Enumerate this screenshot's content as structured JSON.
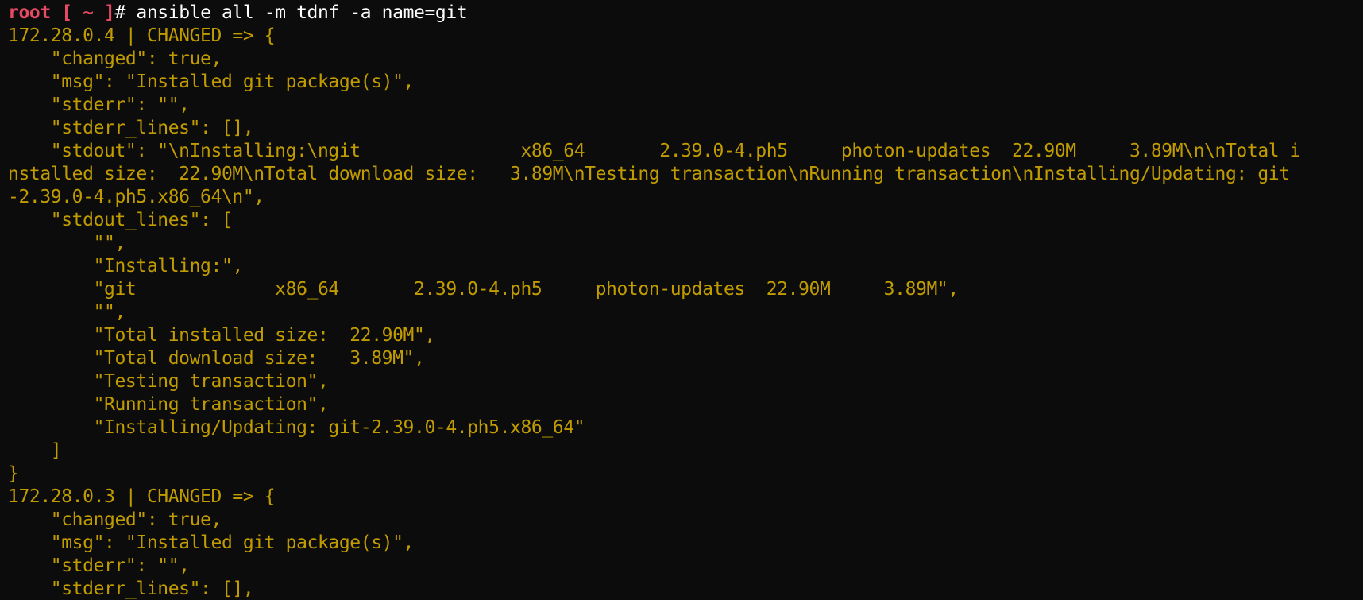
{
  "colors": {
    "background": "#0c0c0c",
    "prompt": "#e84a63",
    "command": "#ffffff",
    "output": "#c19c00"
  },
  "prompt": {
    "user": "root",
    "open_bracket": " [",
    "path": " ~ ",
    "close_bracket": "]",
    "hash": "#",
    "command": " ansible all -m tdnf -a name=git"
  },
  "output_lines": [
    "172.28.0.4 | CHANGED => {",
    "    \"changed\": true,",
    "    \"msg\": \"Installed git package(s)\",",
    "    \"stderr\": \"\",",
    "    \"stderr_lines\": [],",
    "    \"stdout\": \"\\nInstalling:\\ngit               x86_64       2.39.0-4.ph5     photon-updates  22.90M     3.89M\\n\\nTotal i",
    "nstalled size:  22.90M\\nTotal download size:   3.89M\\nTesting transaction\\nRunning transaction\\nInstalling/Updating: git",
    "-2.39.0-4.ph5.x86_64\\n\",",
    "    \"stdout_lines\": [",
    "        \"\",",
    "        \"Installing:\",",
    "        \"git             x86_64       2.39.0-4.ph5     photon-updates  22.90M     3.89M\",",
    "        \"\",",
    "        \"Total installed size:  22.90M\",",
    "        \"Total download size:   3.89M\",",
    "        \"Testing transaction\",",
    "        \"Running transaction\",",
    "        \"Installing/Updating: git-2.39.0-4.ph5.x86_64\"",
    "    ]",
    "}",
    "172.28.0.3 | CHANGED => {",
    "    \"changed\": true,",
    "    \"msg\": \"Installed git package(s)\",",
    "    \"stderr\": \"\",",
    "    \"stderr_lines\": [],"
  ]
}
